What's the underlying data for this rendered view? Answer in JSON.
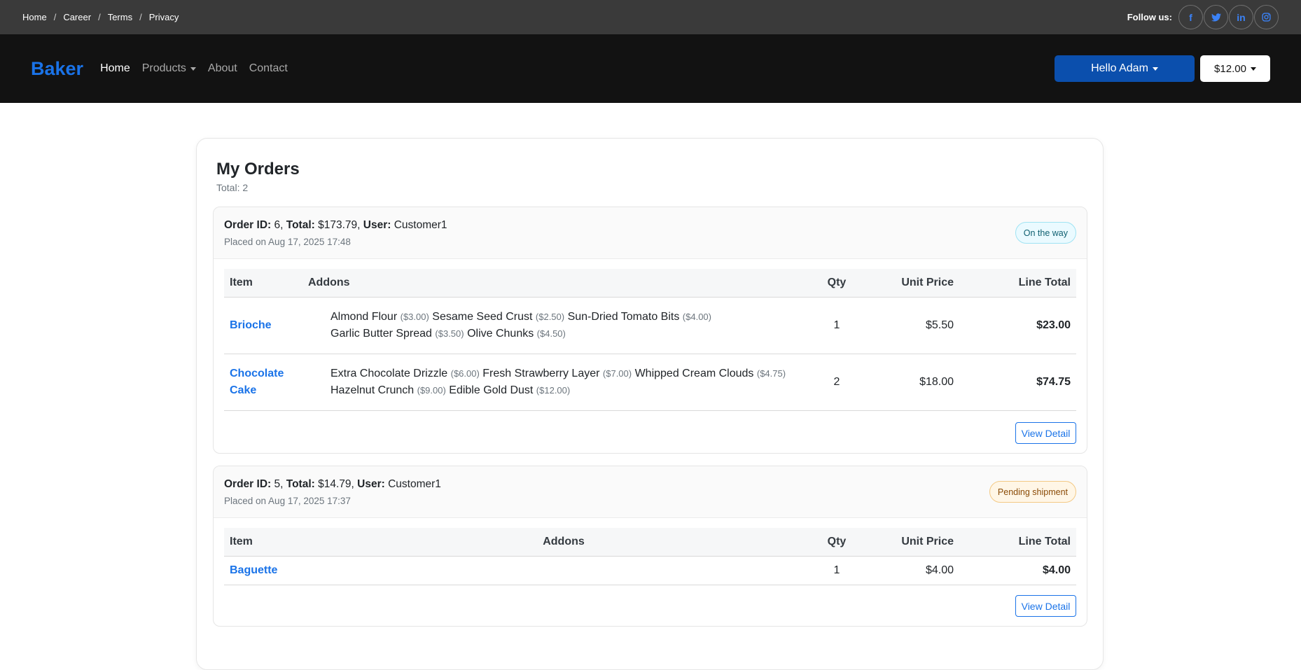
{
  "topbar": {
    "crumbs": [
      "Home",
      "Career",
      "Terms",
      "Privacy"
    ],
    "follow_label": "Follow us:",
    "socials": [
      {
        "icon": "facebook-icon",
        "glyph": "f"
      },
      {
        "icon": "twitter-icon",
        "glyph": "🐦"
      },
      {
        "icon": "linkedin-icon",
        "glyph": "in"
      },
      {
        "icon": "instagram-icon",
        "glyph": "◎"
      }
    ]
  },
  "navbar": {
    "brand": "Baker",
    "links": [
      "Home",
      "Products",
      "About",
      "Contact"
    ],
    "user_menu": "Hello Adam",
    "cart": "$12.00"
  },
  "page": {
    "title": "My Orders",
    "total": "Total: 2"
  },
  "colors": {
    "brand": "#1a73e8",
    "navbar_bg": "#121212",
    "topbar_bg": "#3a3a3a",
    "user_button": "#0b4fad"
  },
  "orders": [
    {
      "id_label": "Order ID:",
      "id": "6",
      "total_label": "Total:",
      "total": "$173.79",
      "user_label": "User:",
      "user": "Customer1",
      "placed": "Placed on Aug 17, 2025 17:48",
      "status": "On the way",
      "headers": [
        "Item",
        "Addons",
        "Qty",
        "Unit Price",
        "Line Total"
      ],
      "items": [
        {
          "name": "Brioche",
          "addons_line1": [
            {
              "name": "Almond Flour",
              "price": "($3.00)"
            },
            {
              "name": "Sesame Seed Crust",
              "price": "($2.50)"
            },
            {
              "name": "Sun-Dried Tomato Bits",
              "price": "($4.00)"
            }
          ],
          "addons_line2": [
            {
              "name": "Garlic Butter Spread",
              "price": "($3.50)"
            },
            {
              "name": "Olive Chunks",
              "price": "($4.50)"
            }
          ],
          "qty": "1",
          "unit_price": "$5.50",
          "line_total": "$23.00"
        },
        {
          "name": "Chocolate Cake",
          "addons_line1": [
            {
              "name": "Extra Chocolate Drizzle",
              "price": "($6.00)"
            },
            {
              "name": "Fresh Strawberry Layer",
              "price": "($7.00)"
            },
            {
              "name": "Whipped Cream Clouds",
              "price": "($4.75)"
            }
          ],
          "addons_line2": [
            {
              "name": "Hazelnut Crunch",
              "price": "($9.00)"
            },
            {
              "name": "Edible Gold Dust",
              "price": "($12.00)"
            }
          ],
          "qty": "2",
          "unit_price": "$18.00",
          "line_total": "$74.75"
        }
      ],
      "view_label": "View Detail"
    },
    {
      "id_label": "Order ID:",
      "id": "5",
      "total_label": "Total:",
      "total": "$14.79",
      "user_label": "User:",
      "user": "Customer1",
      "placed": "Placed on Aug 17, 2025 17:37",
      "status": "Pending shipment",
      "headers": [
        "Item",
        "Addons",
        "Qty",
        "Unit Price",
        "Line Total"
      ],
      "items": [
        {
          "name": "Baguette",
          "qty": "1",
          "unit_price": "$4.00",
          "line_total": "$4.00"
        }
      ],
      "view_label": "View Detail"
    }
  ]
}
